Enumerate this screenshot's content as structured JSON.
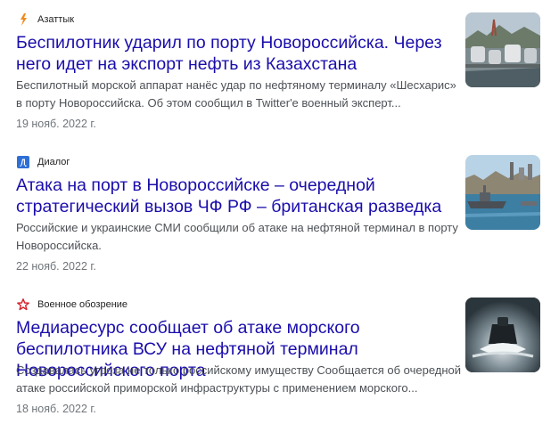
{
  "items": [
    {
      "source": "Азаттык",
      "source_icon": "azattyk-logo-icon",
      "headline": "Беспилотник ударил по порту Новороссийска. Через него идет на экспорт нефть из Казахстана",
      "snippet": "Беспилотный морской аппарат нанёс удар по нефтяному терминалу «Шесхарис» в порту Новороссийска. Об этом сообщил в Twitter'е военный эксперт...",
      "date": "19 нояб. 2022 г.",
      "thumbnail": "oil-terminal-photo"
    },
    {
      "source": "Диалог",
      "source_icon": "dialog-logo-icon",
      "headline": "Атака на порт в Новороссийске – очередной стратегический вызов ЧФ РФ – британская разведка",
      "snippet": "Российские и украинские СМИ сообщили об атаке на нефтяной терминал в порту Новороссийска.",
      "date": "22 нояб. 2022 г.",
      "thumbnail": "port-warship-photo"
    },
    {
      "source": "Военное обозрение",
      "source_icon": "star-logo-icon",
      "headline": "Медиаресурс сообщает об атаке морского беспилотника ВСУ на нефтяной терминал Новороссийского порта",
      "snippet": "Создавалась угроза не только российскому имуществу Сообщается об очередной атаке российской приморской инфраструктуры с применением морского...",
      "date": "18 нояб. 2022 г.",
      "thumbnail": "sea-drone-photo"
    }
  ],
  "colors": {
    "headline": "#1a0dab",
    "snippet": "#4d5156",
    "date": "#70757a",
    "azattyk_accent": "#f08a1c",
    "dialog_accent": "#2d6fd6",
    "star_accent": "#d4202a"
  }
}
